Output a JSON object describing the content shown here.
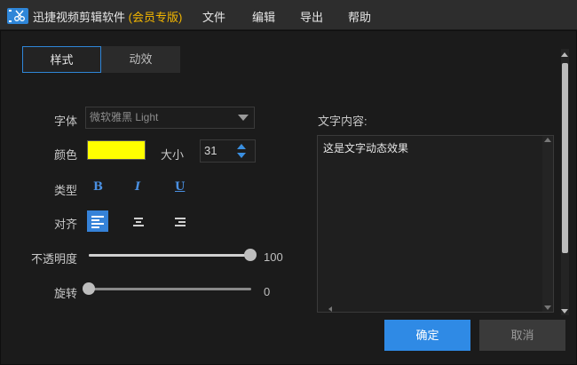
{
  "app": {
    "title": "迅捷视频剪辑软件",
    "edition": "(会员专版)",
    "icon": "scissors-film-icon"
  },
  "menu": [
    "文件",
    "编辑",
    "导出",
    "帮助"
  ],
  "tabs": [
    {
      "label": "样式",
      "active": true
    },
    {
      "label": "动效",
      "active": false
    }
  ],
  "form": {
    "font_label": "字体",
    "font_value": "微软雅黑 Light",
    "color_label": "颜色",
    "color_value": "#ffff00",
    "size_label": "大小",
    "size_value": "31",
    "type_label": "类型",
    "type_buttons": [
      "B",
      "I",
      "U"
    ],
    "align_label": "对齐",
    "align_options": [
      "left",
      "center",
      "right"
    ],
    "align_selected": "left",
    "opacity_label": "不透明度",
    "opacity_value": "100",
    "rotation_label": "旋转",
    "rotation_value": "0"
  },
  "text_content": {
    "label": "文字内容:",
    "value": "这是文字动态效果"
  },
  "buttons": {
    "ok": "确定",
    "cancel": "取消"
  },
  "colors": {
    "accent": "#2f8ae5",
    "vip": "#f5b800",
    "swatch": "#ffff00"
  }
}
